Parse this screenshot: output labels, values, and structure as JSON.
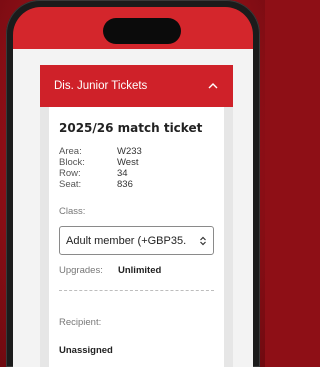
{
  "accordion": {
    "title": "Dis. Junior Tickets",
    "expanded": true
  },
  "ticket": {
    "title": "2025/26 match ticket",
    "fields": [
      {
        "label": "Area:",
        "value": "W233"
      },
      {
        "label": "Block:",
        "value": "West"
      },
      {
        "label": "Row:",
        "value": "34"
      },
      {
        "label": "Seat:",
        "value": "836"
      }
    ],
    "class_label": "Class:",
    "class_selected": "Adult member (+GBP35.",
    "upgrades_label": "Upgrades:",
    "upgrades_value": "Unlimited",
    "recipient_label": "Recipient:",
    "recipient_value": "Unassigned"
  },
  "colors": {
    "accent": "#cf2129",
    "page_bg": "#f3f3f3"
  },
  "icons": {
    "accordion_toggle": "chevron-up-icon",
    "select_toggle": "select-arrows-icon"
  }
}
